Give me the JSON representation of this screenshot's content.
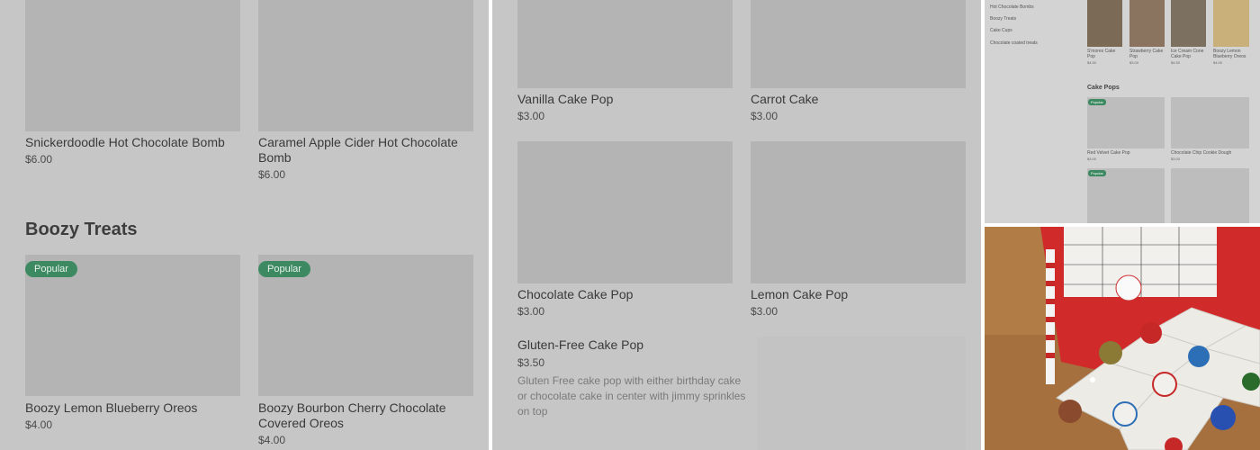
{
  "panel1": {
    "top_items": [
      {
        "name": "Snickerdoodle Hot Chocolate Bomb",
        "price": "$6.00"
      },
      {
        "name": "Caramel Apple Cider Hot Chocolate Bomb",
        "price": "$6.00"
      }
    ],
    "section_title": "Boozy Treats",
    "boozy_items": [
      {
        "badge": "Popular",
        "name": "Boozy Lemon Blueberry Oreos",
        "price": "$4.00"
      },
      {
        "badge": "Popular",
        "name": "Boozy Bourbon Cherry Chocolate Covered Oreos",
        "price": "$4.00"
      }
    ]
  },
  "panel2": {
    "items": [
      {
        "name": "Vanilla Cake Pop",
        "price": "$3.00"
      },
      {
        "name": "Carrot Cake",
        "price": "$3.00"
      },
      {
        "name": "Chocolate Cake Pop",
        "price": "$3.00"
      },
      {
        "name": "Lemon Cake Pop",
        "price": "$3.00"
      }
    ],
    "featured": {
      "name": "Gluten-Free Cake Pop",
      "price": "$3.50",
      "description": "Gluten Free cake pop with either birthday cake or chocolate cake in center with jimmy sprinkles on top"
    }
  },
  "panel3": {
    "nav": [
      "Hot Chocolate Bombs",
      "Boozy Treats",
      "Cake Cups",
      "Chocolate coated treats"
    ],
    "top_items": [
      {
        "name": "S'mores Cake Pop",
        "price": "$4.50"
      },
      {
        "name": "Strawberry Cake Pop",
        "price": "$3.00"
      },
      {
        "name": "Ice Cream Cone Cake Pop",
        "price": "$4.50"
      },
      {
        "name": "Boozy Lemon Blueberry Oreos",
        "price": "$4.00"
      }
    ],
    "section_title": "Cake Pops",
    "badge": "Popular",
    "cake_pops": [
      {
        "name": "Red Velvet Cake Pop",
        "price": "$3.00"
      },
      {
        "name": "Chocolate Chip Cookie Dough",
        "price": "$3.00"
      }
    ]
  },
  "colors": {
    "overlay_gray": "#c6c6c6",
    "image_placeholder": "#b4b4b4",
    "badge_green": "#3d8a62"
  }
}
